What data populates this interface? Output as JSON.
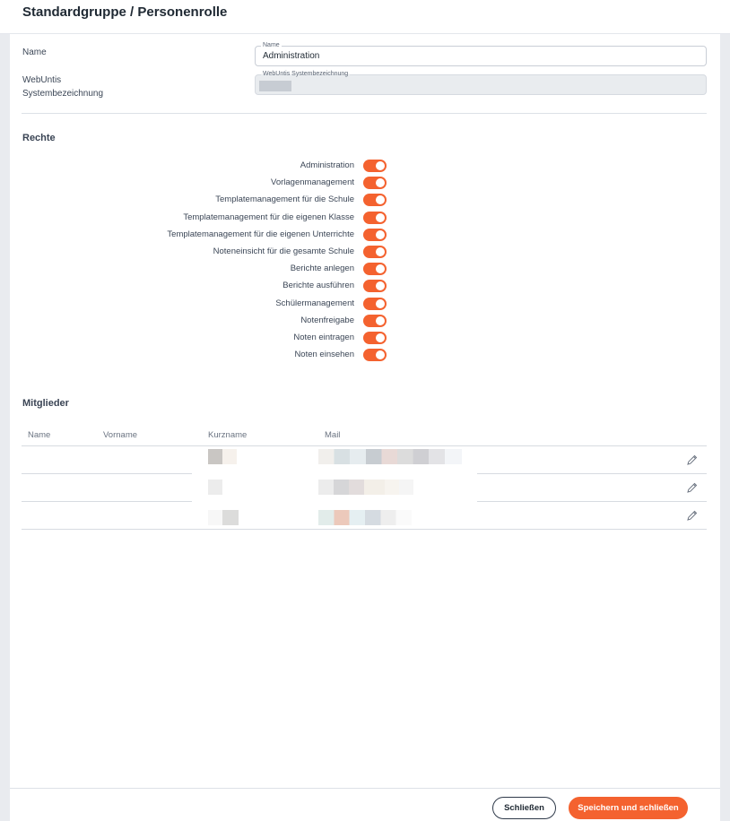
{
  "dialog": {
    "title": "Standardgruppe / Personenrolle"
  },
  "form": {
    "name_label": "Name",
    "name_legend": "Name",
    "name_value": "Administration",
    "webuntis_label_line1": "WebUntis",
    "webuntis_label_line2": "Systembezeichnung",
    "webuntis_legend": "WebUntis Systembezeichnung"
  },
  "rights": {
    "title": "Rechte",
    "items": [
      {
        "label": "Administration",
        "enabled": true
      },
      {
        "label": "Vorlagenmanagement",
        "enabled": true
      },
      {
        "label": "Templatemanagement für die Schule",
        "enabled": true
      },
      {
        "label": "Templatemanagement für die eigenen Klasse",
        "enabled": true
      },
      {
        "label": "Templatemanagement für die eigenen Unterrichte",
        "enabled": true
      },
      {
        "label": "Noteneinsicht für die gesamte Schule",
        "enabled": true
      },
      {
        "label": "Berichte anlegen",
        "enabled": true
      },
      {
        "label": "Berichte ausführen",
        "enabled": true
      },
      {
        "label": "Schülermanagement",
        "enabled": true
      },
      {
        "label": "Notenfreigabe",
        "enabled": true
      },
      {
        "label": "Noten eintragen",
        "enabled": true
      },
      {
        "label": "Noten einsehen",
        "enabled": true
      }
    ]
  },
  "members": {
    "title": "Mitglieder",
    "columns": [
      "Name",
      "Vorname",
      "Kurzname",
      "Mail"
    ],
    "rows_count_visible": 3
  },
  "footer": {
    "close_label": "Schließen",
    "save_label": "Speichern und schließen"
  },
  "colors": {
    "accent": "#f4622f",
    "text": "#2f3a4a"
  }
}
